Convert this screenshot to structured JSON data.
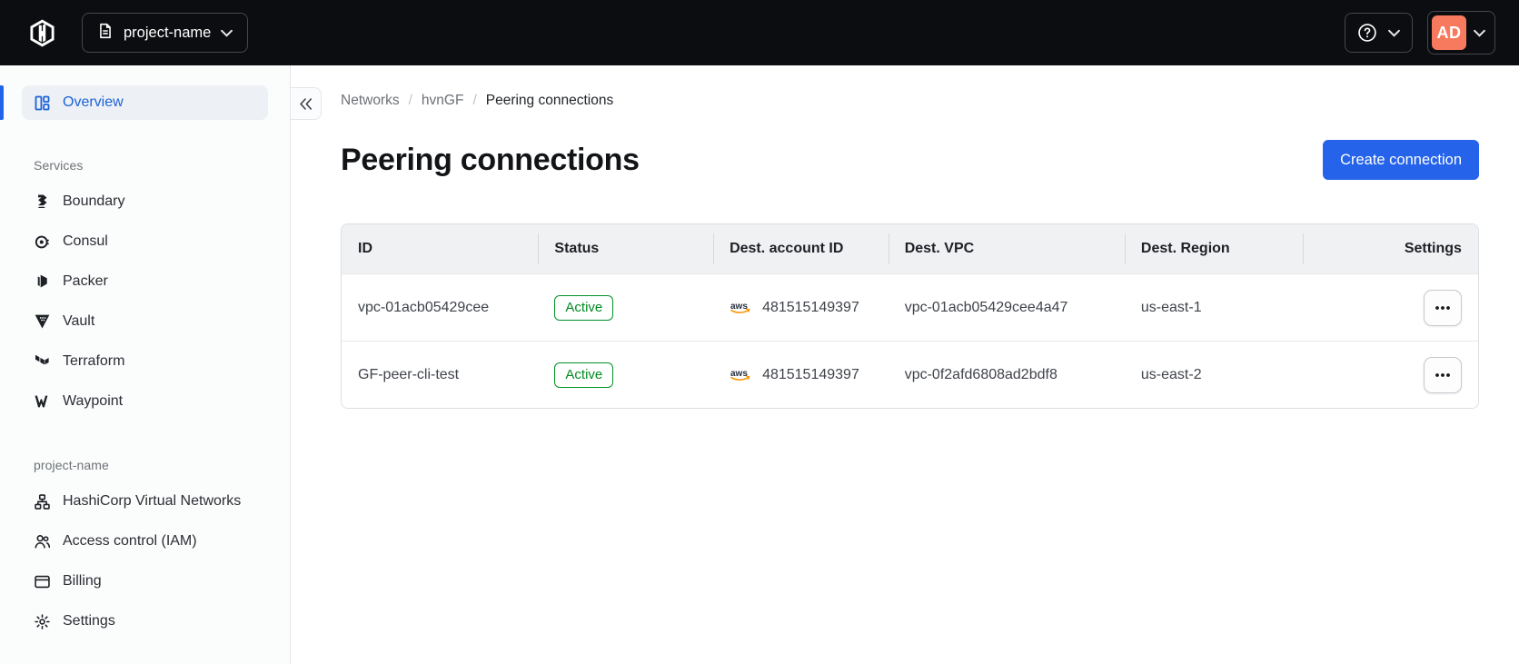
{
  "navbar": {
    "project_switcher_label": "project-name",
    "account_initials": "AD"
  },
  "sidebar": {
    "collapse_glyph": "«",
    "overview_label": "Overview",
    "services_header": "Services",
    "services": [
      {
        "label": "Boundary"
      },
      {
        "label": "Consul"
      },
      {
        "label": "Packer"
      },
      {
        "label": "Vault"
      },
      {
        "label": "Terraform"
      },
      {
        "label": "Waypoint"
      }
    ],
    "project_header": "project-name",
    "project_items": [
      {
        "label": "HashiCorp Virtual Networks"
      },
      {
        "label": "Access control (IAM)"
      },
      {
        "label": "Billing"
      },
      {
        "label": "Settings"
      }
    ]
  },
  "breadcrumb": {
    "separator": "/",
    "items": [
      "Networks",
      "hvnGF",
      "Peering connections"
    ]
  },
  "page": {
    "title": "Peering connections",
    "create_button_label": "Create connection"
  },
  "table": {
    "headers": [
      "ID",
      "Status",
      "Dest. account ID",
      "Dest. VPC",
      "Dest. Region",
      "Settings"
    ],
    "rows": [
      {
        "id": "vpc-01acb05429cee",
        "status": "Active",
        "provider": "aws",
        "dest_account_id": "481515149397",
        "dest_vpc": "vpc-01acb05429cee4a47",
        "dest_region": "us-east-1"
      },
      {
        "id": "GF-peer-cli-test",
        "status": "Active",
        "provider": "aws",
        "dest_account_id": "481515149397",
        "dest_vpc": "vpc-0f2afd6808ad2bdf8",
        "dest_region": "us-east-2"
      }
    ]
  },
  "icons": {
    "hashicorp-logo": "hexagon-h",
    "document-icon": "file-text",
    "help-icon": "question-circle",
    "chevron-down-icon": "chevron-down",
    "collapse-sidebar-icon": "double-chevron-left",
    "overview-icon": "dashboard-grid",
    "boundary-icon": "boundary-mark",
    "consul-icon": "consul-mark",
    "packer-icon": "packer-mark",
    "vault-icon": "vault-mark",
    "terraform-icon": "terraform-mark",
    "waypoint-icon": "waypoint-mark",
    "network-icon": "org-chart",
    "users-icon": "two-people",
    "billing-icon": "credit-card",
    "settings-icon": "gear",
    "aws-icon": "aws-smile-logo",
    "kebab-icon": "ellipsis"
  },
  "colors": {
    "navbar_bg": "#0c0d10",
    "accent_blue": "#2064ec",
    "active_link_blue": "#1c63d8",
    "primary_button_blue": "#2463ea",
    "badge_green": "#008a22",
    "aws_orange": "#f79400",
    "aws_navy": "#252f3e",
    "avatar_coral": "#f87a5e"
  }
}
